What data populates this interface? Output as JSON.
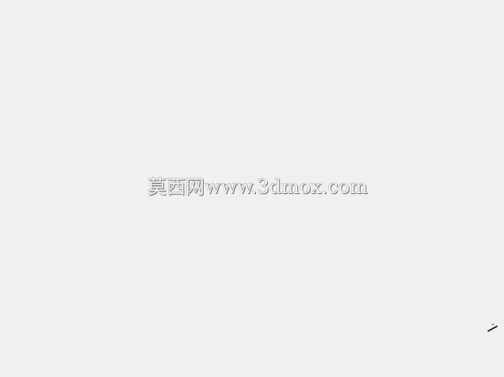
{
  "window": {
    "background_color": "#f0f0f0"
  },
  "watermark": {
    "text": "莫西网www.3dmox.com"
  },
  "corner_mark": {
    "icon": "resize-grip-icon",
    "color": "#111111"
  }
}
